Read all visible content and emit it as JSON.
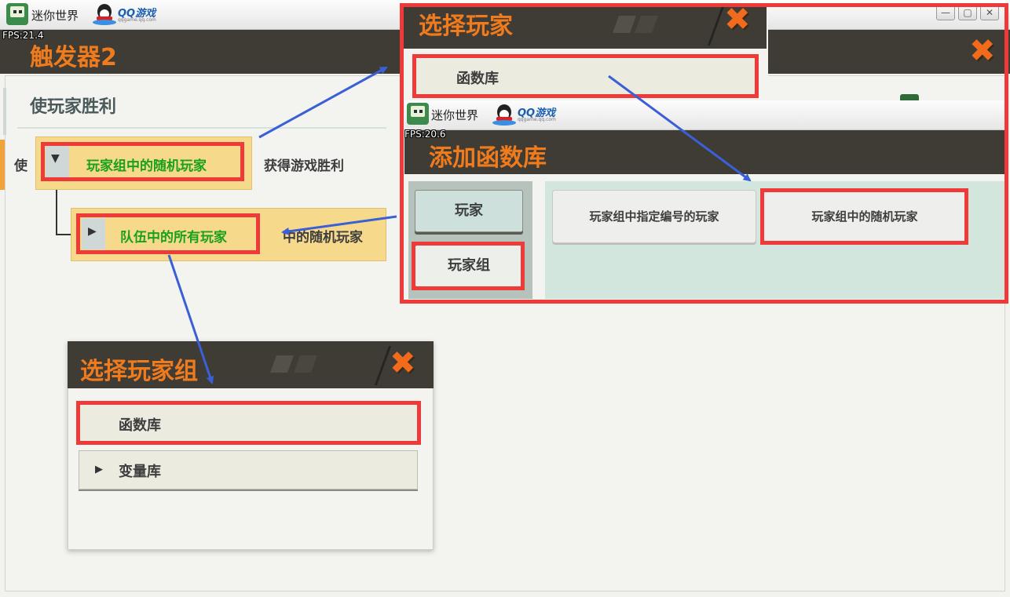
{
  "window": {
    "app_name": "迷你世界",
    "qq_brand": "QQ游戏",
    "qq_domain": "qqgame.qq.com",
    "fps": "FPS:21.4",
    "minimize_glyph": "—",
    "maximize_glyph": "▢",
    "close_glyph": "✕"
  },
  "trigger_panel": {
    "title": "触发器2",
    "close_glyph": "✖",
    "section_title": "使玩家胜利",
    "make_label": "使",
    "param_primary": "玩家组中的随机玩家",
    "expand_open_glyph": "▼",
    "suffix_label": "获得游戏胜利",
    "param_secondary": "队伍中的所有玩家",
    "expand_closed_glyph": "▶",
    "secondary_suffix": "中的随机玩家"
  },
  "select_player_dialog": {
    "title": "选择玩家",
    "close_glyph": "✖",
    "item": "函数库"
  },
  "add_function_dialog": {
    "app_name": "迷你世界",
    "qq_brand": "QQ游戏",
    "qq_domain": "qqgame.qq.com",
    "fps": "FPS:20.6",
    "title": "添加函数库",
    "tabs": [
      {
        "label": "玩家"
      },
      {
        "label": "玩家组"
      }
    ],
    "functions": [
      {
        "label": "玩家组中指定编号的玩家"
      },
      {
        "label": "玩家组中的随机玩家"
      }
    ]
  },
  "select_group_dialog": {
    "title": "选择玩家组",
    "close_glyph": "✖",
    "items": [
      {
        "label": "函数库"
      },
      {
        "label": "变量库",
        "glyph": "▶"
      }
    ]
  },
  "colors": {
    "orange_title": "#f07b1c",
    "highlight_red": "#ef3a3a",
    "annotation_arrow": "#3a5fd6",
    "slot_yellow": "#f7d98b",
    "green_text": "#19a11e",
    "dark_header": "#3f3c36"
  }
}
